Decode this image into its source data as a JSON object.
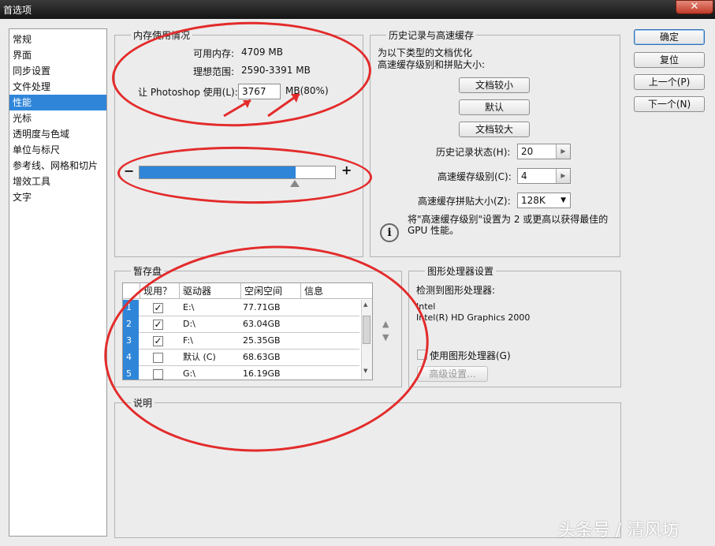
{
  "window": {
    "title": "首选项",
    "close_label": "✕"
  },
  "sidebar": {
    "items": [
      {
        "label": "常规"
      },
      {
        "label": "界面"
      },
      {
        "label": "同步设置"
      },
      {
        "label": "文件处理"
      },
      {
        "label": "性能"
      },
      {
        "label": "光标"
      },
      {
        "label": "透明度与色域"
      },
      {
        "label": "单位与标尺"
      },
      {
        "label": "参考线、网格和切片"
      },
      {
        "label": "增效工具"
      },
      {
        "label": "文字"
      }
    ],
    "selected": "性能"
  },
  "memory": {
    "legend": "内存使用情况",
    "available_label": "可用内存:",
    "available_value": "4709 MB",
    "ideal_label": "理想范围:",
    "ideal_value": "2590-3391 MB",
    "use_label": "让 Photoshop 使用(L):",
    "use_value": "3767",
    "use_unit": "MB(80%)",
    "slider_fraction": 0.8,
    "minus": "−",
    "plus": "+"
  },
  "history": {
    "legend": "历史记录与高速缓存",
    "desc1": "为以下类型的文档优化",
    "desc2": "高速缓存级别和拼贴大小:",
    "btn_small": "文档较小",
    "btn_default": "默认",
    "btn_large": "文档较大",
    "states_label": "历史记录状态(H):",
    "states_value": "20",
    "levels_label": "高速缓存级别(C):",
    "levels_value": "4",
    "tile_label": "高速缓存拼贴大小(Z):",
    "tile_value": "128K",
    "info_text": "将\"高速缓存级别\"设置为 2 或更高以获得最佳的 GPU 性能。"
  },
  "buttons": {
    "ok": "确定",
    "reset": "复位",
    "prev": "上一个(P)",
    "next": "下一个(N)"
  },
  "scratch": {
    "legend": "暂存盘",
    "headers": {
      "active": "现用？",
      "drive": "驱动器",
      "free": "空闲空间",
      "info": "信息"
    },
    "rows": [
      {
        "num": "1",
        "checked": true,
        "drive": "E:\\",
        "free": "77.71GB"
      },
      {
        "num": "2",
        "checked": true,
        "drive": "D:\\",
        "free": "63.04GB"
      },
      {
        "num": "3",
        "checked": true,
        "drive": "F:\\",
        "free": "25.35GB"
      },
      {
        "num": "4",
        "checked": false,
        "drive": "默认 (C)",
        "free": "68.63GB"
      },
      {
        "num": "5",
        "checked": false,
        "drive": "G:\\",
        "free": "16.19GB"
      }
    ]
  },
  "gpu": {
    "legend": "图形处理器设置",
    "detected_label": "检测到图形处理器:",
    "vendor": "Intel",
    "model": "Intel(R) HD Graphics 2000",
    "use_label": "使用图形处理器(G)",
    "advanced_label": "高级设置..."
  },
  "description": {
    "legend": "说明"
  },
  "watermark": "头条号 / 清风坊",
  "colors": {
    "accent": "#2f86d9",
    "annotation": "#e32b2b"
  }
}
